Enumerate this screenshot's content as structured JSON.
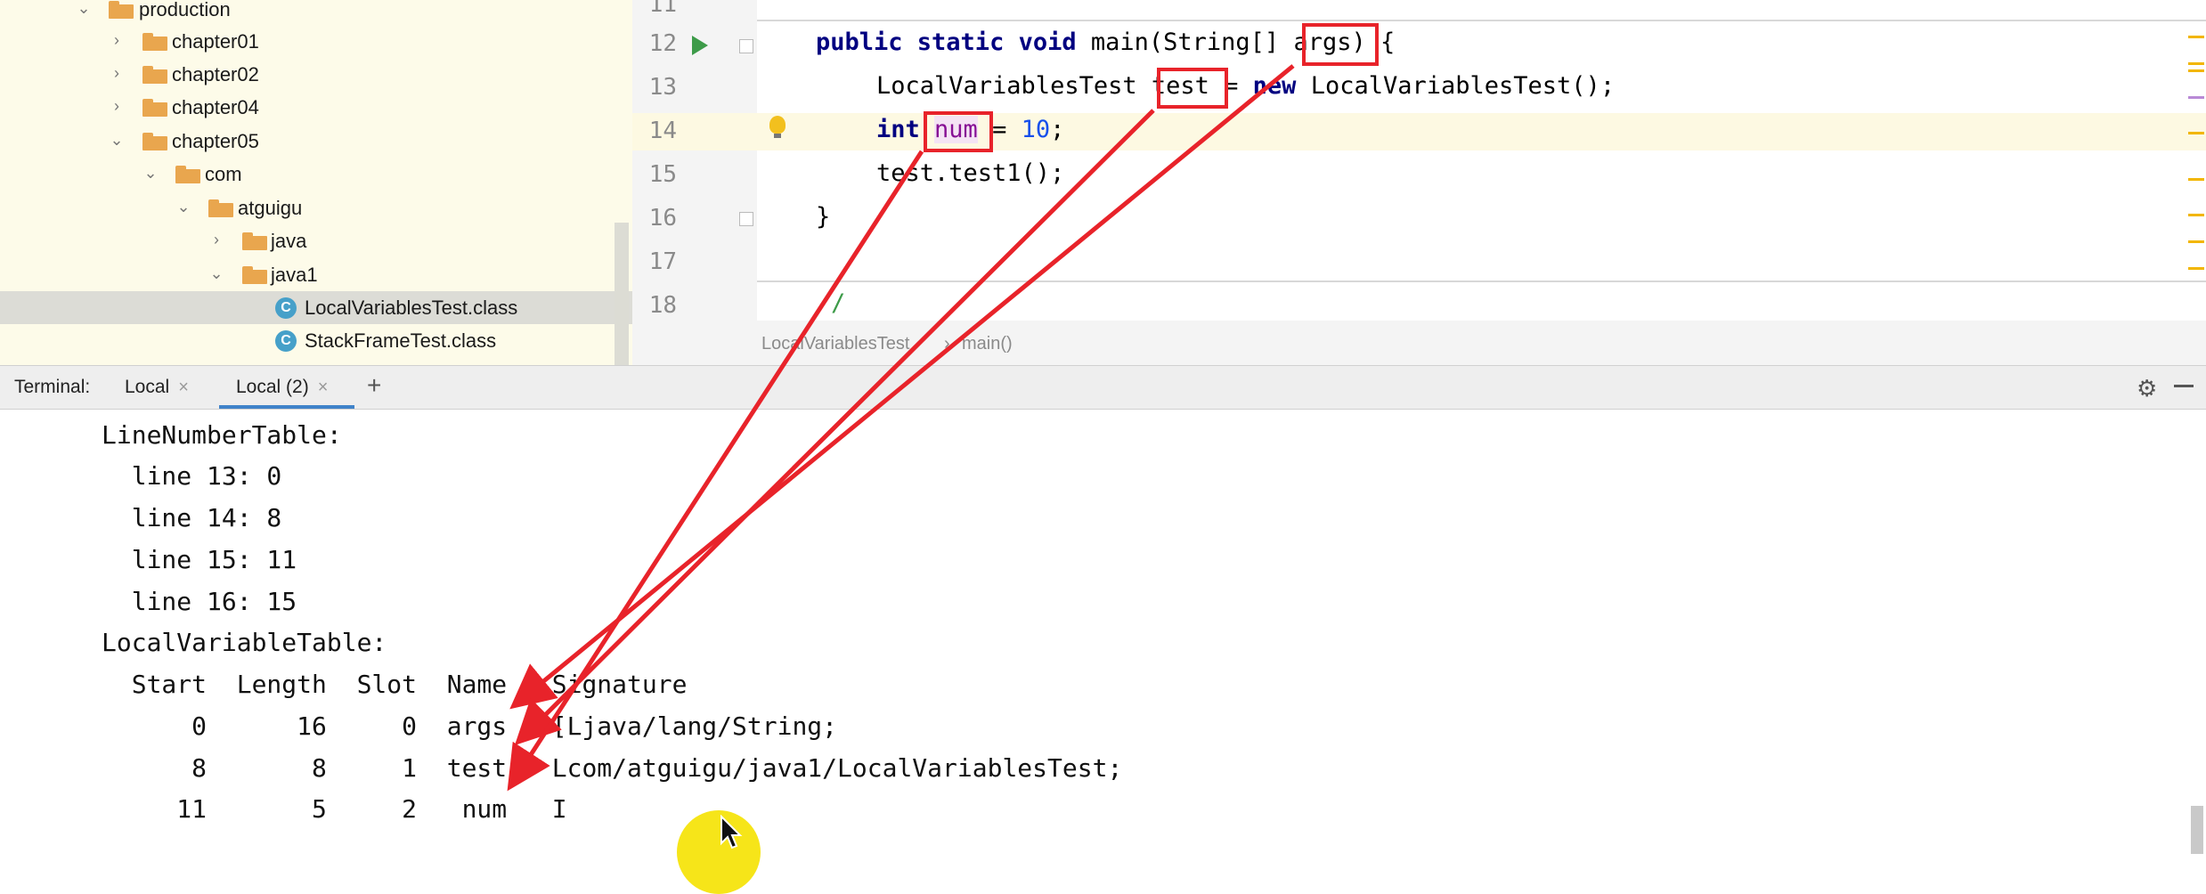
{
  "project_tree": [
    {
      "label": "production",
      "expanded": true
    },
    {
      "label": "chapter01",
      "expanded": false
    },
    {
      "label": "chapter02",
      "expanded": false
    },
    {
      "label": "chapter04",
      "expanded": false
    },
    {
      "label": "chapter05",
      "expanded": true
    },
    {
      "label": "com",
      "expanded": true
    },
    {
      "label": "atguigu",
      "expanded": true
    },
    {
      "label": "java",
      "expanded": false
    },
    {
      "label": "java1",
      "expanded": true
    },
    {
      "label": "LocalVariablesTest.class",
      "selected": true
    },
    {
      "label": "StackFrameTest.class"
    }
  ],
  "editor": {
    "line_numbers": [
      "11",
      "12",
      "13",
      "14",
      "15",
      "16",
      "17",
      "18"
    ],
    "line12": {
      "kw": "public static void",
      "text1": " main(String[] ",
      "args": "args",
      "text2": ") {"
    },
    "line13": {
      "text1": "LocalVariablesTest ",
      "test": "test",
      "text2": " = ",
      "kw": "new",
      "text3": " LocalVariablesTest();"
    },
    "line14": {
      "kw": "int",
      "num_var": "num",
      "text1": " = ",
      "value": "10",
      "text2": ";"
    },
    "line15": "test.test1();",
    "line16": "}",
    "line18": "/"
  },
  "breadcrumb": {
    "class": "LocalVariablesTest",
    "separator": "›",
    "method": "main()"
  },
  "terminal": {
    "label": "Terminal:",
    "tabs": [
      "Local",
      "Local (2)"
    ],
    "active_tab": "Local (2)",
    "add_label": "+",
    "lines": [
      "LineNumberTable:",
      "  line 13: 0",
      "  line 14: 8",
      "  line 15: 11",
      "  line 16: 15",
      "LocalVariableTable:",
      "  Start  Length  Slot  Name   Signature",
      "      0      16     0  args   [Ljava/lang/String;",
      "      8       8     1  test   Lcom/atguigu/java1/LocalVariablesTest;",
      "     11       5     2   num   I"
    ]
  },
  "colors": {
    "annotation": "#e8232a",
    "cursor_highlight": "#f5e200",
    "tree_bg": "#fdfbe9",
    "active_tab": "#4083c9"
  }
}
